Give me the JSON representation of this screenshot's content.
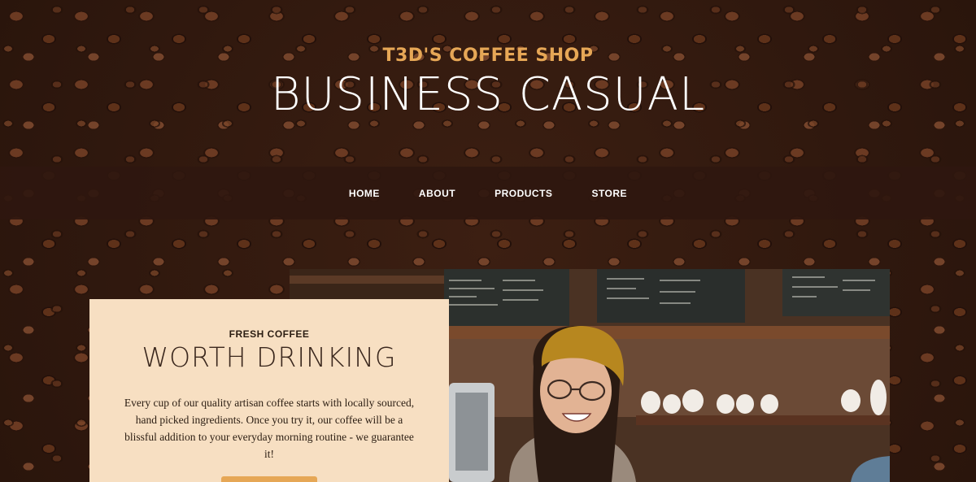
{
  "site": {
    "heading_upper": "T3D'S COFFEE SHOP",
    "heading_lower": "BUSINESS CASUAL"
  },
  "nav": {
    "items": [
      {
        "label": "HOME"
      },
      {
        "label": "ABOUT"
      },
      {
        "label": "PRODUCTS"
      },
      {
        "label": "STORE"
      }
    ]
  },
  "intro": {
    "upper": "FRESH COFFEE",
    "lower": "WORTH DRINKING",
    "text": "Every cup of our quality artisan coffee starts with locally sourced, hand picked ingredients. Once you try it, our coffee will be a blissful addition to your everyday morning routine - we guarantee it!"
  },
  "colors": {
    "accent": "#e6a756",
    "nav_bg": "#2f170f",
    "intro_bg": "#f7dfc2",
    "text_dark": "#2b1d12"
  },
  "icons": {
    "background": "coffee-beans-background",
    "photo": "barista-photo"
  }
}
